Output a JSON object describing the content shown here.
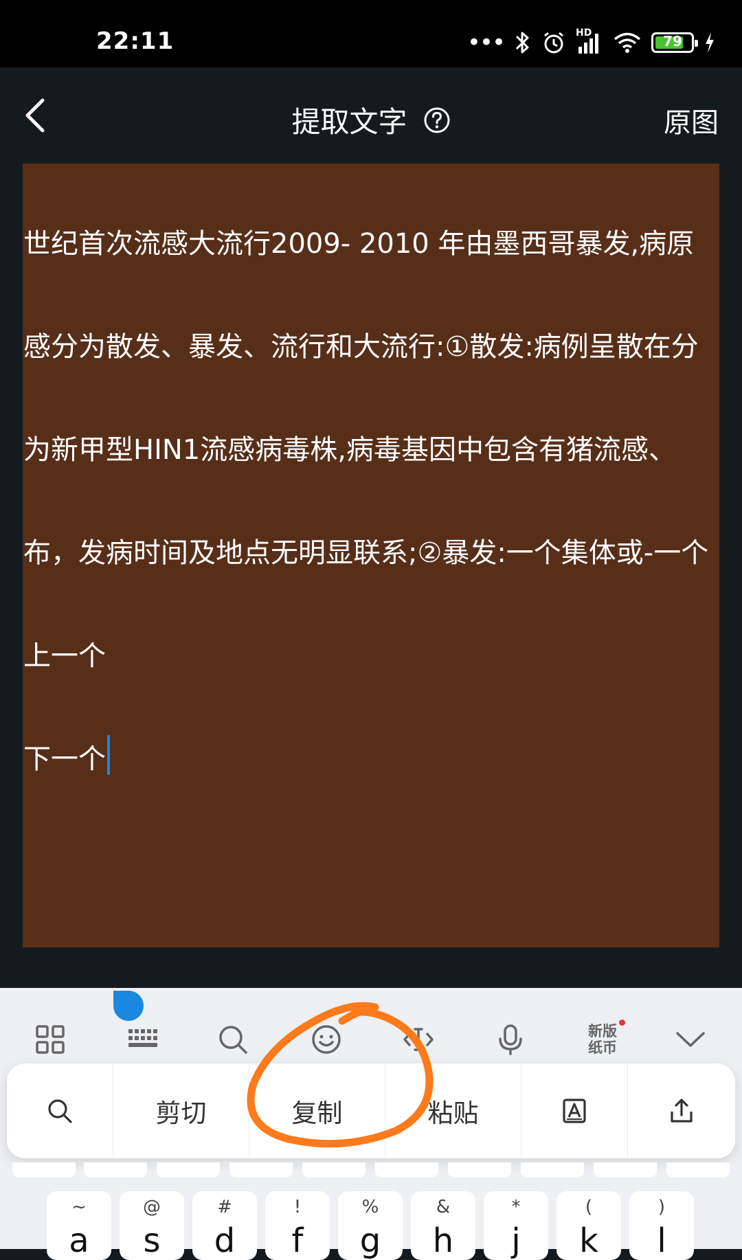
{
  "status_bar": {
    "time": "22:11",
    "network": "HD",
    "battery": "79"
  },
  "header": {
    "title": "提取文字",
    "right_button": "原图"
  },
  "content": {
    "paragraphs": [
      "世纪首次流感大流行2009- 2010 年由墨西哥暴发,病原",
      "感分为散发、暴发、流行和大流行:①散发:病例呈散在分",
      "为新甲型HIN1流感病毒株,病毒基因中包含有猪流感、",
      "布，发病时间及地点无明显联系;②暴发:一个集体或-一个",
      "上一个",
      "下一个"
    ]
  },
  "keyboard": {
    "toolbar": {
      "new_paper_line1": "新版",
      "new_paper_line2": "纸币"
    },
    "edit_menu": {
      "cut": "剪切",
      "copy": "复制",
      "paste": "粘贴"
    },
    "keys": [
      {
        "sym": "~",
        "main": "a"
      },
      {
        "sym": "@",
        "main": "s"
      },
      {
        "sym": "#",
        "main": "d"
      },
      {
        "sym": "!",
        "main": "f"
      },
      {
        "sym": "%",
        "main": "g"
      },
      {
        "sym": "&",
        "main": "h"
      },
      {
        "sym": "*",
        "main": "j"
      },
      {
        "sym": "(",
        "main": "k"
      },
      {
        "sym": ")",
        "main": "l"
      }
    ]
  },
  "colors": {
    "highlight": "#572e18",
    "cursor": "#1a88e0",
    "annotation": "#ff7a1a",
    "battery": "#49c42e"
  }
}
